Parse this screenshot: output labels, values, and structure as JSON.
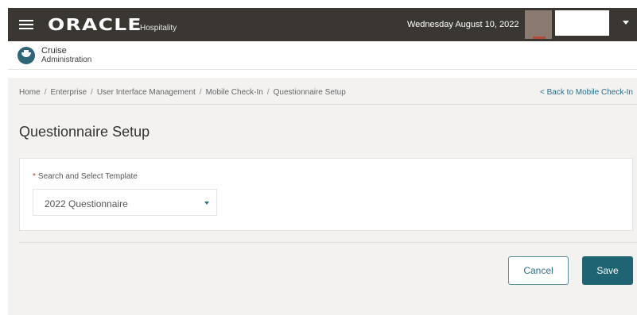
{
  "header": {
    "brand": "ORACLE",
    "brand_sub": "Hospitality",
    "date": "Wednesday August 10, 2022"
  },
  "module": {
    "line1": "Cruise",
    "line2": "Administration"
  },
  "breadcrumb": [
    "Home",
    "Enterprise",
    "User Interface Management",
    "Mobile Check-In",
    "Questionnaire Setup"
  ],
  "back_link": "< Back to Mobile Check-In",
  "page_title": "Questionnaire Setup",
  "form": {
    "template_label": "Search and Select Template",
    "template_value": "2022 Questionnaire"
  },
  "actions": {
    "cancel": "Cancel",
    "save": "Save"
  },
  "colors": {
    "header_bg": "#3a3632",
    "accent": "#1f6473",
    "link": "#2a6f8a",
    "required": "#c0392b"
  }
}
